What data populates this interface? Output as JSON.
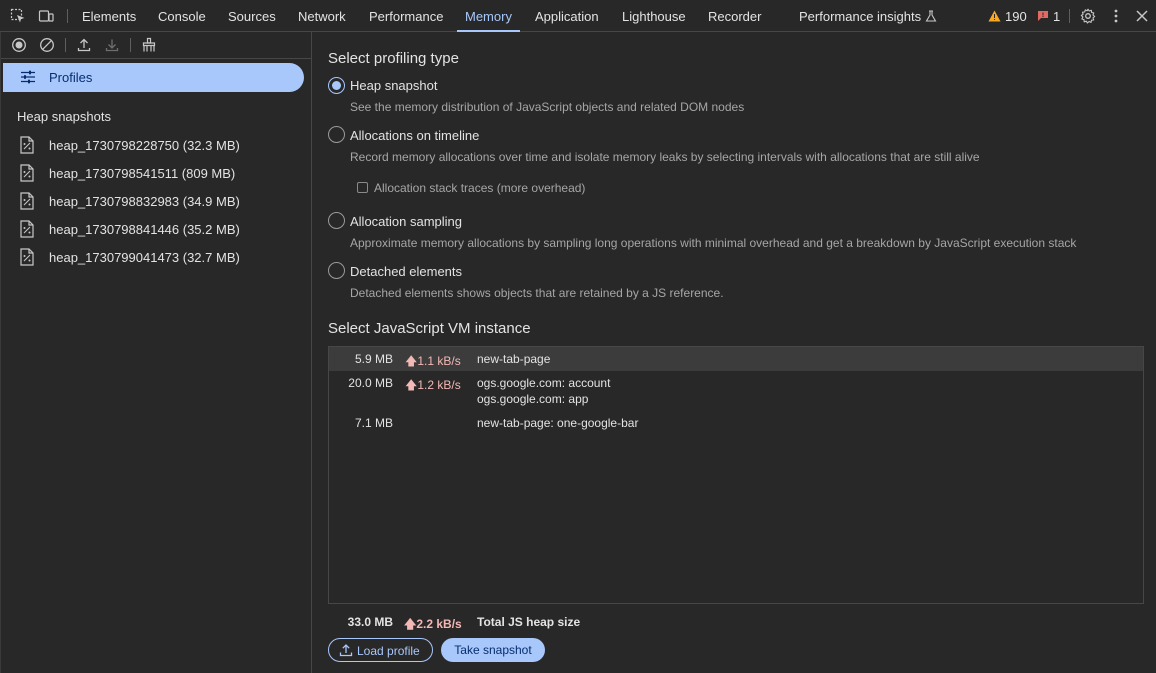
{
  "toolbar": {
    "tabs": [
      {
        "label": "Elements"
      },
      {
        "label": "Console"
      },
      {
        "label": "Sources"
      },
      {
        "label": "Network"
      },
      {
        "label": "Performance"
      },
      {
        "label": "Memory"
      },
      {
        "label": "Application"
      },
      {
        "label": "Lighthouse"
      },
      {
        "label": "Recorder"
      },
      {
        "label": "Performance insights"
      }
    ],
    "active_tab": "Memory",
    "warnings_count": "190",
    "errors_count": "1",
    "icons": [
      "inspect-element-icon",
      "device-toolbar-icon",
      "flask-icon",
      "warning-icon",
      "error-icon",
      "gear-icon",
      "more-vertical-icon",
      "close-icon"
    ]
  },
  "sidebar": {
    "toolbar_icons": [
      "record-icon",
      "clear-icon",
      "upload-icon",
      "download-icon",
      "collect-garbage-icon"
    ],
    "profiles_label": "Profiles",
    "heap_header": "Heap snapshots",
    "snapshots": [
      {
        "label": "heap_1730798228750 (32.3 MB)"
      },
      {
        "label": "heap_1730798541511 (809 MB)"
      },
      {
        "label": "heap_1730798832983 (34.9 MB)"
      },
      {
        "label": "heap_1730798841446 (35.2 MB)"
      },
      {
        "label": "heap_1730799041473 (32.7 MB)"
      }
    ]
  },
  "main": {
    "profiling_title": "Select profiling type",
    "options": [
      {
        "label": "Heap snapshot",
        "desc": "See the memory distribution of JavaScript objects and related DOM nodes",
        "checked": true
      },
      {
        "label": "Allocations on timeline",
        "desc": "Record memory allocations over time and isolate memory leaks by selecting intervals with allocations that are still alive",
        "checked": false
      },
      {
        "label": "Allocation sampling",
        "desc": "Approximate memory allocations by sampling long operations with minimal overhead and get a breakdown by JavaScript execution stack",
        "checked": false
      },
      {
        "label": "Detached elements",
        "desc": "Detached elements shows objects that are retained by a JS reference.",
        "checked": false
      }
    ],
    "stack_traces_label": "Allocation stack traces (more overhead)",
    "vm_title": "Select JavaScript VM instance",
    "vm_instances": [
      {
        "size": "5.9 MB",
        "rate": "1.1 kB/s",
        "names": [
          "new-tab-page"
        ]
      },
      {
        "size": "20.0 MB",
        "rate": "1.2 kB/s",
        "names": [
          "ogs.google.com: account",
          "ogs.google.com: app"
        ]
      },
      {
        "size": "7.1 MB",
        "rate": "",
        "names": [
          "new-tab-page: one-google-bar"
        ]
      }
    ],
    "total": {
      "size": "33.0 MB",
      "rate": "2.2 kB/s",
      "label": "Total JS heap size"
    },
    "load_button": "Load profile",
    "take_button": "Take snapshot"
  },
  "colors": {
    "accent": "#a8c7fa",
    "background": "#282828",
    "rate": "#f2b8b5",
    "warning": "#f9a825",
    "error": "#e46962"
  }
}
